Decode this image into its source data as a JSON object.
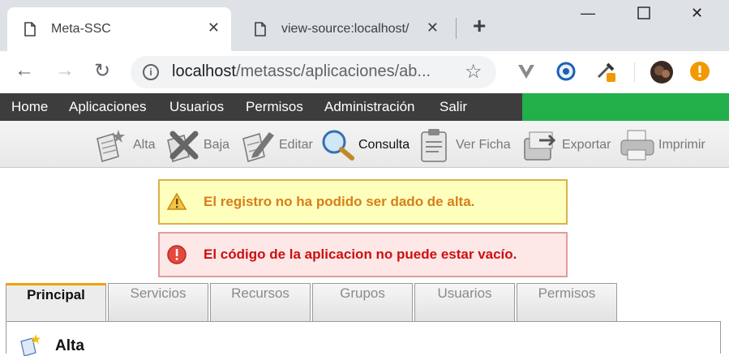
{
  "browser": {
    "tabs": [
      {
        "title": "Meta-SSC",
        "active": true
      },
      {
        "title": "view-source:localhost/",
        "active": false
      }
    ],
    "address": {
      "host": "localhost",
      "path": "/metassc/aplicaciones/ab..."
    }
  },
  "menu": {
    "items": [
      "Home",
      "Aplicaciones",
      "Usuarios",
      "Permisos",
      "Administración",
      "Salir"
    ],
    "accent_color": "#22b04b"
  },
  "toolbar": {
    "actions": [
      {
        "label": "Alta",
        "icon": "add-document-icon"
      },
      {
        "label": "Baja",
        "icon": "delete-icon"
      },
      {
        "label": "Editar",
        "icon": "edit-document-icon"
      },
      {
        "label": "Consulta",
        "icon": "magnifier-icon"
      },
      {
        "label": "Ver Ficha",
        "icon": "clipboard-icon"
      },
      {
        "label": "Exportar",
        "icon": "export-icon"
      },
      {
        "label": "Imprimir",
        "icon": "printer-icon"
      }
    ]
  },
  "messages": {
    "warning": "El registro no ha podido ser dado de alta.",
    "error": "El código de la aplicacion no puede estar vacío."
  },
  "tabs": {
    "items": [
      "Principal",
      "Servicios",
      "Recursos",
      "Grupos",
      "Usuarios",
      "Permisos"
    ],
    "active": "Principal"
  },
  "panel": {
    "title": "Alta"
  }
}
